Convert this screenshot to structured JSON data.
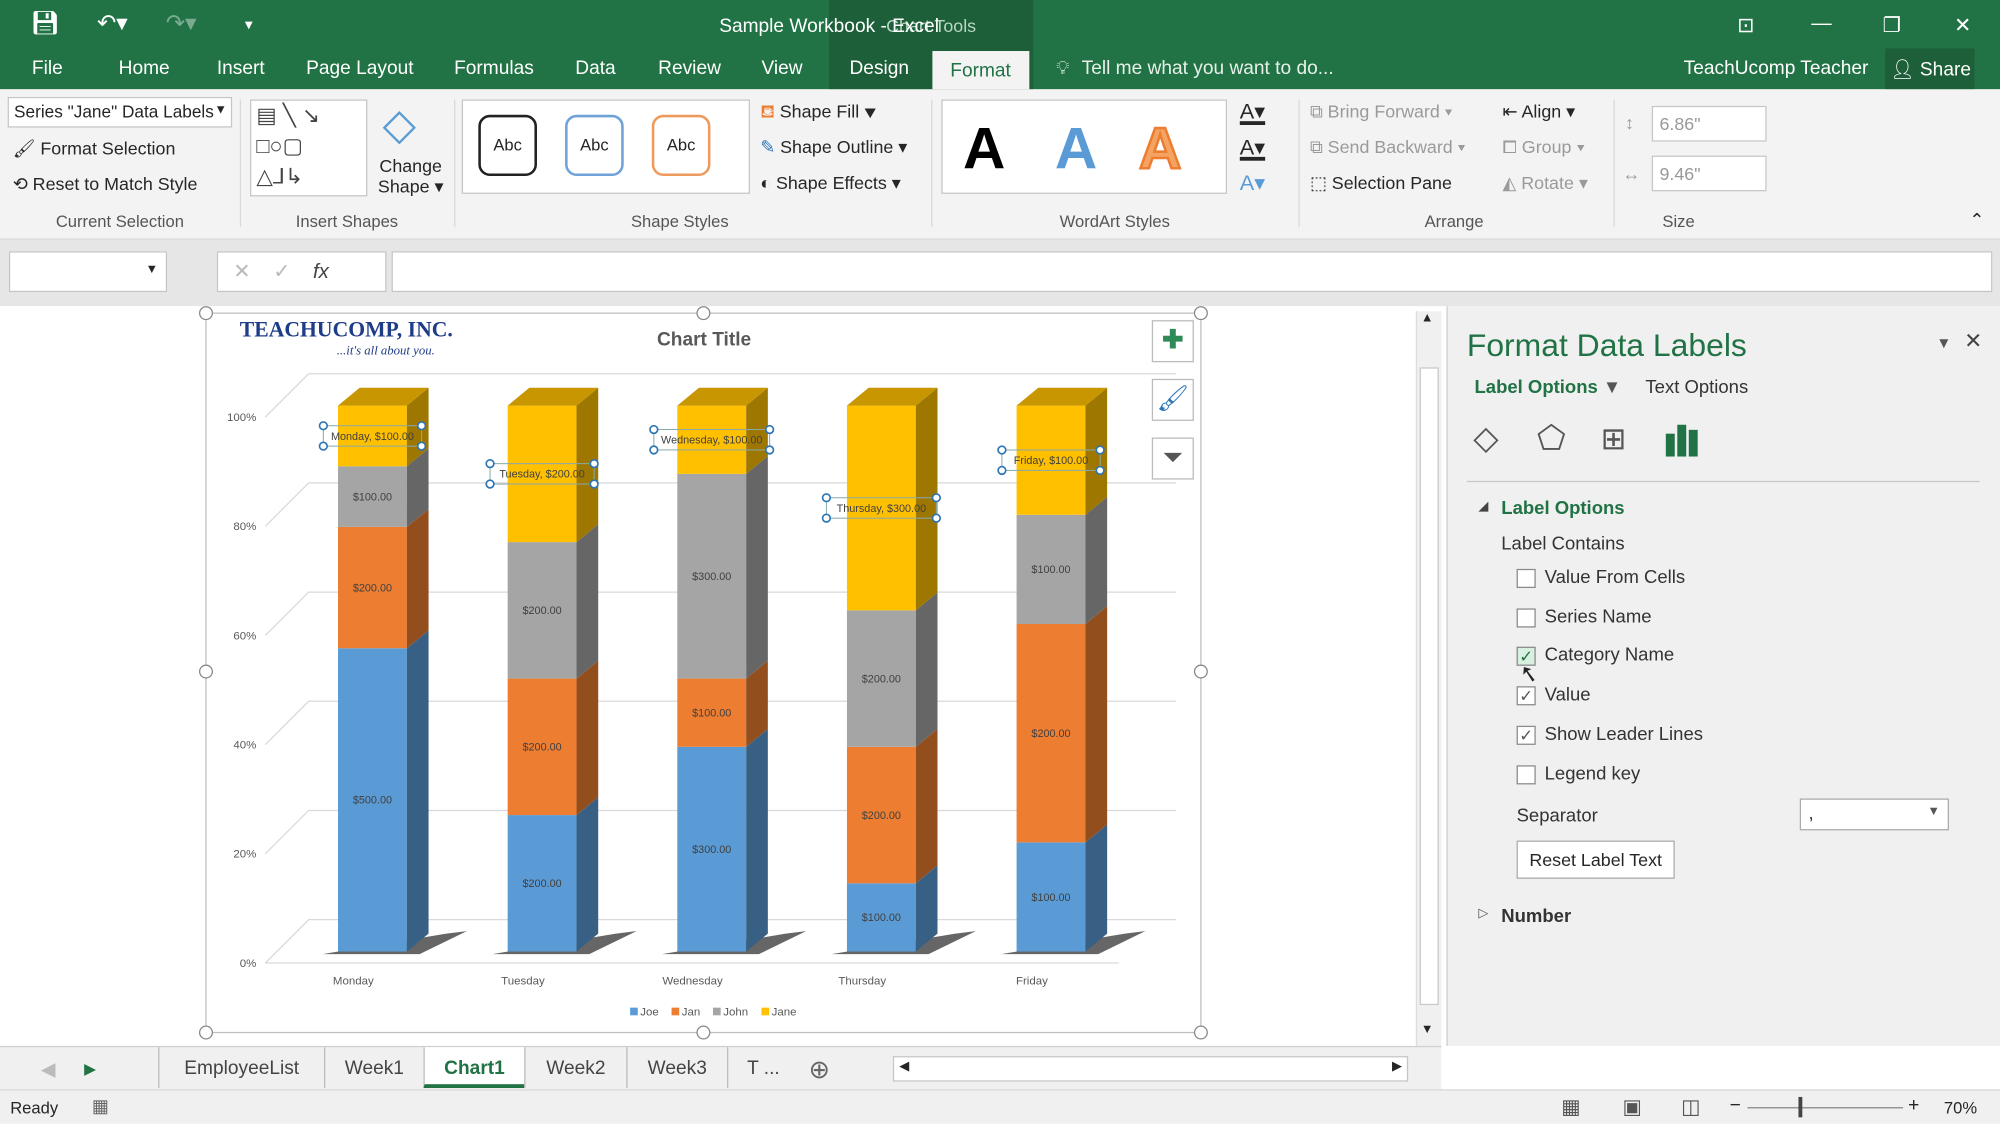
{
  "title_bar": {
    "title": "Sample Workbook - Excel",
    "context_tab": "Chart Tools"
  },
  "tabs": [
    "File",
    "Home",
    "Insert",
    "Page Layout",
    "Formulas",
    "Data",
    "Review",
    "View",
    "Design",
    "Format"
  ],
  "active_tab": "Format",
  "tell_me": "Tell me what you want to do...",
  "user": "TeachUcomp Teacher",
  "share": "Share",
  "ribbon": {
    "current_selection": {
      "dropdown": "Series \"Jane\" Data Labels",
      "format_selection": "Format Selection",
      "reset": "Reset to Match Style",
      "label": "Current Selection"
    },
    "insert_shapes": {
      "change_shape": "Change",
      "change_shape2": "Shape",
      "label": "Insert Shapes"
    },
    "shape_styles": {
      "samples": [
        "Abc",
        "Abc",
        "Abc"
      ],
      "fill": "Shape Fill",
      "outline": "Shape Outline",
      "effects": "Shape Effects",
      "label": "Shape Styles"
    },
    "wordart": {
      "samples": [
        "A",
        "A",
        "A"
      ],
      "label": "WordArt Styles"
    },
    "arrange": {
      "bring_forward": "Bring Forward",
      "send_backward": "Send Backward",
      "selection_pane": "Selection Pane",
      "align": "Align",
      "group": "Group",
      "rotate": "Rotate",
      "label": "Arrange"
    },
    "size": {
      "height": "6.86\"",
      "width": "9.46\"",
      "label": "Size"
    }
  },
  "formula_bar": {
    "name_box": "",
    "fx": "fx",
    "cancel": "✕",
    "enter": "✓"
  },
  "logo": {
    "name": "TEACHUCOMP, INC.",
    "tagline": "...it's all about you."
  },
  "chart_data": {
    "type": "bar",
    "stacked": "percent",
    "style": "3d-column",
    "title": "Chart Title",
    "categories": [
      "Monday",
      "Tuesday",
      "Wednesday",
      "Thursday",
      "Friday"
    ],
    "series": [
      {
        "name": "Joe",
        "values": [
          500,
          200,
          300,
          100,
          100
        ],
        "color": "#5b9bd5"
      },
      {
        "name": "Jan",
        "values": [
          200,
          200,
          100,
          200,
          200
        ],
        "color": "#ed7d31"
      },
      {
        "name": "John",
        "values": [
          100,
          200,
          300,
          200,
          100
        ],
        "color": "#a5a5a5"
      },
      {
        "name": "Jane",
        "values": [
          100,
          200,
          100,
          300,
          100
        ],
        "color": "#ffc000"
      }
    ],
    "y_ticks": [
      "0%",
      "20%",
      "40%",
      "60%",
      "80%",
      "100%"
    ],
    "ylim": [
      0,
      100
    ],
    "grid": true,
    "legend": "bottom",
    "selected_series_labels": "Jane"
  },
  "pane": {
    "title": "Format Data Labels",
    "tab_label_options": "Label Options",
    "tab_text_options": "Text Options",
    "section": "Label Options",
    "label_contains": "Label Contains",
    "options": [
      {
        "label": "Value From Cells",
        "checked": false
      },
      {
        "label": "Series Name",
        "checked": false
      },
      {
        "label": "Category Name",
        "checked": true
      },
      {
        "label": "Value",
        "checked": true
      },
      {
        "label": "Show Leader Lines",
        "checked": true
      },
      {
        "label": "Legend key",
        "checked": false
      }
    ],
    "separator_label": "Separator",
    "separator_value": ",",
    "reset_button": "Reset Label Text",
    "number_section": "Number"
  },
  "sheet_tabs": [
    "EmployeeList",
    "Week1",
    "Chart1",
    "Week2",
    "Week3",
    "T ..."
  ],
  "active_sheet": "Chart1",
  "status": {
    "ready": "Ready",
    "zoom": "70%"
  }
}
